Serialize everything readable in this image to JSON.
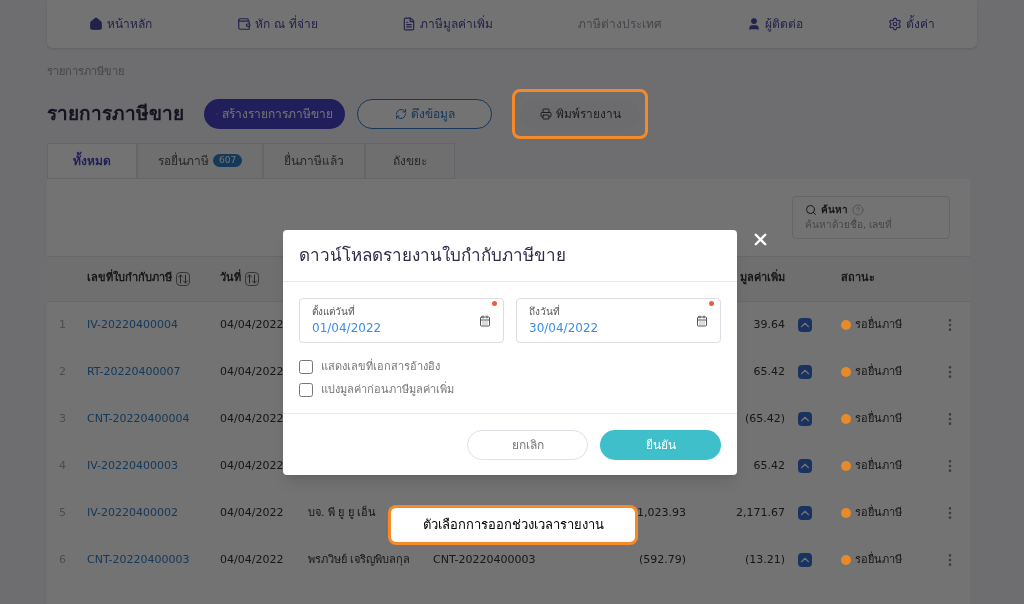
{
  "nav": [
    {
      "label": "หน้าหลัก",
      "disabled": false
    },
    {
      "label": "หัก ณ ที่จ่าย",
      "disabled": false
    },
    {
      "label": "ภาษีมูลค่าเพิ่ม",
      "disabled": false
    },
    {
      "label": "ภาษีต่างประเทศ",
      "disabled": true
    },
    {
      "label": "ผู้ติดต่อ",
      "disabled": false
    },
    {
      "label": "ตั้งค่า",
      "disabled": false
    }
  ],
  "breadcrumb": "รายการภาษีขาย",
  "page_title": "รายการภาษีขาย",
  "actions": [
    {
      "kind": "primary",
      "label": "สร้างรายการภาษีขาย"
    },
    {
      "kind": "outline",
      "label": "ดึงข้อมูล"
    },
    {
      "kind": "plain",
      "label": "พิมพ์รายงาน",
      "highlighted": true
    }
  ],
  "tabs": [
    {
      "label": "ทั้งหมด",
      "selected": true
    },
    {
      "label": "รอยื่นภาษี",
      "badge": "607",
      "selected": false
    },
    {
      "label": "ยื่นภาษีแล้ว",
      "selected": false
    },
    {
      "label": "ถังขยะ",
      "selected": false
    }
  ],
  "search": {
    "label": "ค้นหา",
    "placeholder": "ค้นหาด้วยชื่อ, เลขที่"
  },
  "table": {
    "columns": [
      {
        "label": "เลขที่ใบกำกับภาษี",
        "sortable": true
      },
      {
        "label": "วันที่",
        "sortable": true
      },
      {
        "label": "มูลค่าเพิ่ม"
      },
      {
        "label": "สถานะ"
      }
    ],
    "rows": [
      {
        "index": "1",
        "invoice_no": "IV-20220400004",
        "date": "04/04/2022",
        "vat": "39.64",
        "status": "รอยื่นภาษี",
        "color": "#e8892a"
      },
      {
        "index": "2",
        "invoice_no": "RT-20220400007",
        "date": "04/04/2022",
        "vat": "65.42",
        "status": "รอยื่นภาษี",
        "color": "#e8892a"
      },
      {
        "index": "3",
        "invoice_no": "CNT-20220400004",
        "date": "04/04/2022",
        "vat": "(65.42)",
        "status": "รอยื่นภาษี",
        "color": "#e8892a"
      },
      {
        "index": "4",
        "invoice_no": "IV-20220400003",
        "date": "04/04/2022",
        "vat": "65.42",
        "status": "รอยื่นภาษี",
        "color": "#e8892a"
      },
      {
        "index": "5",
        "invoice_no": "IV-20220400002",
        "date": "04/04/2022",
        "customer": "บจ. พี ยู ยู เอ็น",
        "amount": "1,023.93",
        "vat": "2,171.67",
        "status": "รอยื่นภาษี",
        "color": "#e8892a"
      },
      {
        "index": "6",
        "invoice_no": "CNT-20220400003",
        "date": "04/04/2022",
        "customer": "พรภวิษย์ เจริญพิบลกุล",
        "reference": "CNT-20220400003",
        "amount": "(592.79)",
        "vat": "(13.21)",
        "status": "รอยื่นภาษี",
        "color": "#e8892a"
      }
    ]
  },
  "dialog": {
    "title": "ดาวน์โหลดรายงานใบกำกับภาษีขาย",
    "fields": [
      {
        "label": "ตั้งแต่วันที่",
        "value": "01/04/2022",
        "required": true
      },
      {
        "label": "ถึงวันที่",
        "value": "30/04/2022",
        "required": true
      }
    ],
    "options": [
      {
        "label": "แสดงเลขที่เอกสารอ้างอิง",
        "checked": false
      },
      {
        "label": "แบ่งมูลค่าก่อนภาษีมูลค่าเพิ่ม",
        "checked": false
      }
    ],
    "buttons": [
      {
        "kind": "cancel",
        "label": "ยกเลิก"
      },
      {
        "kind": "confirm",
        "label": "ยืนยัน"
      }
    ]
  },
  "callout": "ตัวเลือกการออกช่วงเวลารายงาน"
}
